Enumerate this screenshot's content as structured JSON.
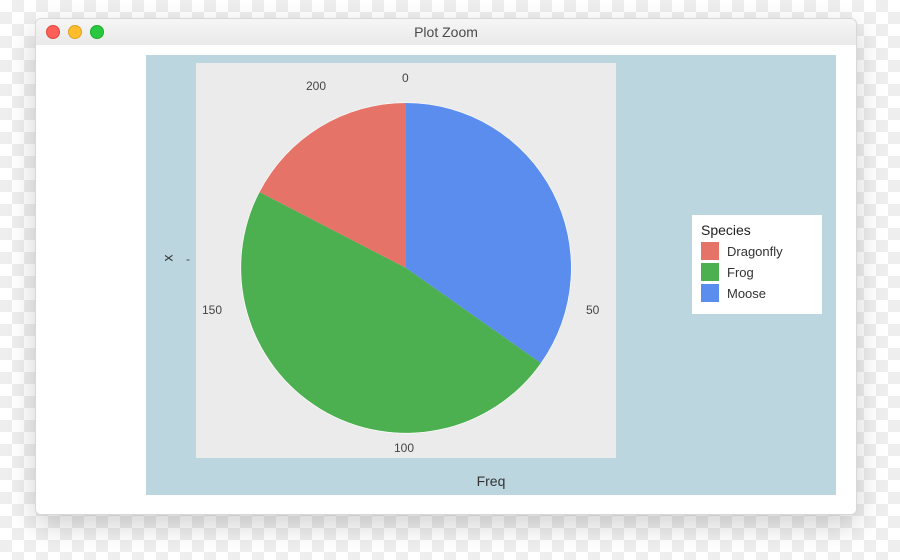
{
  "window": {
    "title": "Plot Zoom"
  },
  "axis": {
    "xlabel": "Freq",
    "ylabel": "x",
    "ytick": "-",
    "ticks": {
      "t0": "0",
      "t50": "50",
      "t100": "100",
      "t150": "150",
      "t200": "200"
    }
  },
  "legend": {
    "title": "Species",
    "items": [
      {
        "label": "Dragonfly",
        "color": "#e57368"
      },
      {
        "label": "Frog",
        "color": "#4caf50"
      },
      {
        "label": "Moose",
        "color": "#5b8def"
      }
    ]
  },
  "chart_data": {
    "type": "pie",
    "title": "",
    "xlabel": "Freq",
    "ylabel": "x",
    "categories": [
      "Dragonfly",
      "Frog",
      "Moose"
    ],
    "series": [
      {
        "name": "Freq",
        "values": [
          40,
          110,
          80
        ]
      }
    ],
    "total": 230,
    "radial_ticks": [
      0,
      50,
      100,
      150,
      200
    ],
    "colors": {
      "Dragonfly": "#e57368",
      "Frog": "#4caf50",
      "Moose": "#5b8def"
    },
    "legend_position": "right",
    "note": "polar stacked bar rendered as pie (coord_polar); cumulative boundaries ≈ 0,80,190,230 clockwise from top"
  }
}
